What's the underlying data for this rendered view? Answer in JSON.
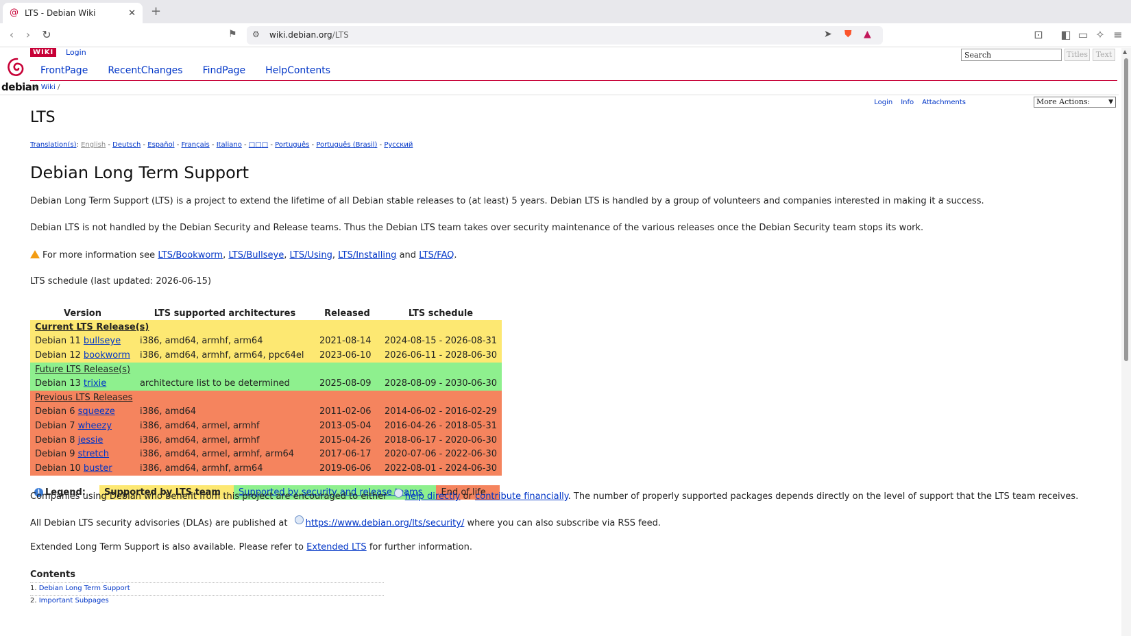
{
  "browser": {
    "tab_title": "LTS - Debian Wiki",
    "url_host": "wiki.debian.org",
    "url_path": "/LTS"
  },
  "wiki": {
    "badge": "WIKI",
    "login": "Login",
    "logo_text": "debian",
    "nav": [
      "FrontPage",
      "RecentChanges",
      "FindPage",
      "HelpContents"
    ],
    "breadcrumb_sep": "/",
    "breadcrumb_wiki": "Wiki",
    "breadcrumb_tail": "/",
    "search_value": "Search",
    "titles_btn": "Titles",
    "text_btn": "Text",
    "actions": [
      "Login",
      "Info",
      "Attachments"
    ],
    "more_actions": "More Actions:"
  },
  "page": {
    "title": "LTS",
    "translations_label": "Translation(s)",
    "translations_current": "English",
    "translations": [
      "Deutsch",
      "Español",
      "Français",
      "Italiano",
      "□□□",
      "Português",
      "Português (Brasil)",
      "Русский"
    ],
    "heading": "Debian Long Term Support",
    "para1": "Debian Long Term Support (LTS) is a project to extend the lifetime of all Debian stable releases to (at least) 5 years. Debian LTS is handled by a group of volunteers and companies interested in making it a success.",
    "para2": "Debian LTS is not handled by the Debian Security and Release teams. Thus the Debian LTS team takes over security maintenance of the various releases once the Debian Security team stops its work.",
    "more_info_prefix": "For more information see",
    "more_info_links": [
      "LTS/Bookworm",
      "LTS/Bullseye",
      "LTS/Using",
      "LTS/Installing"
    ],
    "more_info_and": "and",
    "more_info_last": "LTS/FAQ",
    "schedule_label": "LTS schedule (last updated: 2026-06-15)"
  },
  "table": {
    "headers": [
      "Version",
      "LTS supported architectures",
      "Released",
      "LTS schedule"
    ],
    "current_label": "Current LTS Release(s)",
    "future_label": "Future LTS Release(s)",
    "previous_label": "Previous LTS Releases",
    "current": [
      {
        "ver": "Debian 11",
        "code": "bullseye",
        "arch": "i386, amd64, armhf, arm64",
        "released": "2021-08-14",
        "schedule": "2024-08-15 - 2026-08-31"
      },
      {
        "ver": "Debian 12",
        "code": "bookworm",
        "arch": "i386, amd64, armhf, arm64, ppc64el",
        "released": "2023-06-10",
        "schedule": "2026-06-11 - 2028-06-30"
      }
    ],
    "future": [
      {
        "ver": "Debian 13",
        "code": "trixie",
        "arch": "architecture list to be determined",
        "released": "2025-08-09",
        "schedule": "2028-08-09 - 2030-06-30"
      }
    ],
    "previous": [
      {
        "ver": "Debian 6",
        "code": "squeeze",
        "arch": "i386, amd64",
        "released": "2011-02-06",
        "schedule": "2014-06-02 - 2016-02-29"
      },
      {
        "ver": "Debian 7",
        "code": "wheezy",
        "arch": "i386, amd64, armel, armhf",
        "released": "2013-05-04",
        "schedule": "2016-04-26 - 2018-05-31"
      },
      {
        "ver": "Debian 8",
        "code": "jessie",
        "arch": "i386, amd64, armel, armhf",
        "released": "2015-04-26",
        "schedule": "2018-06-17 - 2020-06-30"
      },
      {
        "ver": "Debian 9",
        "code": "stretch",
        "arch": "i386, amd64, armel, armhf, arm64",
        "released": "2017-06-17",
        "schedule": "2020-07-06 - 2022-06-30"
      },
      {
        "ver": "Debian 10",
        "code": "buster",
        "arch": "i386, amd64, armhf, arm64",
        "released": "2019-06-06",
        "schedule": "2022-08-01 - 2024-06-30"
      }
    ]
  },
  "legend": {
    "label": "Legend:",
    "lts": "Supported by LTS team",
    "security": "Supported by security and release teams",
    "eol": "End of life"
  },
  "after": {
    "companies_prefix": "Companies using Debian who benefit from this project are encouraged to either",
    "help_link": "help directly",
    "or": "or",
    "contrib_link": "contribute financially",
    "companies_suffix": ". The number of properly supported packages depends directly on the level of support that the LTS team receives.",
    "dla_prefix": "All Debian LTS security advisories (DLAs) are published at",
    "dla_link": "https://www.debian.org/lts/security/",
    "dla_suffix": "where you can also subscribe via RSS feed.",
    "elts_prefix": "Extended Long Term Support is also available. Please refer to",
    "elts_link": "Extended LTS",
    "elts_suffix": "for further information."
  },
  "toc": {
    "title": "Contents",
    "items": [
      {
        "num": "1.",
        "label": "Debian Long Term Support"
      },
      {
        "num": "2.",
        "label": "Important Subpages"
      }
    ]
  }
}
